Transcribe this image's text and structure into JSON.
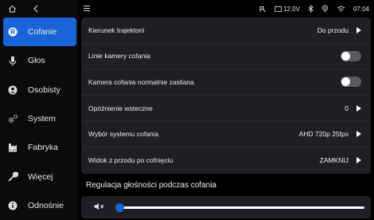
{
  "statusbar": {
    "home_icon": "home-icon",
    "back_icon": "back-icon",
    "menu_icon": "menu-icon",
    "voltage": "12.0V",
    "time": "07:04"
  },
  "sidebar": {
    "items": [
      {
        "label": "Cofanie",
        "icon": "reverse-icon",
        "active": true
      },
      {
        "label": "Głos",
        "icon": "microphone-icon"
      },
      {
        "label": "Osobisty",
        "icon": "personal-icon"
      },
      {
        "label": "System",
        "icon": "settings-icon"
      },
      {
        "label": "Fabryka",
        "icon": "factory-icon"
      },
      {
        "label": "Więcej",
        "icon": "wrench-icon"
      },
      {
        "label": "Odnośnie",
        "icon": "info-icon"
      }
    ]
  },
  "settings": {
    "rows": [
      {
        "label": "Kierunek trajektorii",
        "value": "Do przodu",
        "type": "select"
      },
      {
        "label": "Linie kamery cofania",
        "type": "toggle",
        "state": false
      },
      {
        "label": "Kamera cofania normalnie zasilana",
        "type": "toggle",
        "state": false
      },
      {
        "label": "Opóźnienie wsteczne",
        "value": "0",
        "type": "select"
      },
      {
        "label": "Wybór systemu cofania",
        "value": "AHD 720p 25fps",
        "type": "select"
      },
      {
        "label": "Widok z przodu po cofnięciu",
        "value": "ZAMKNIJ",
        "type": "select"
      }
    ]
  },
  "volume": {
    "title": "Regulacja głośności podczas cofania",
    "icon": "volume-mute-icon",
    "level_percent": 0
  },
  "colors": {
    "accent": "#1a64d8",
    "panel": "#1e1f22",
    "background": "#000000"
  }
}
